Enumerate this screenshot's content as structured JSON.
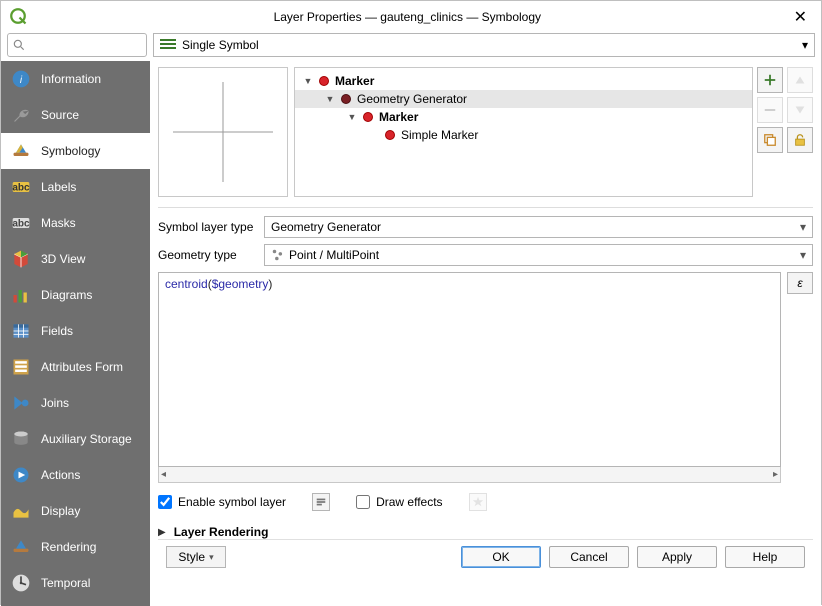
{
  "window": {
    "title": "Layer Properties — gauteng_clinics — Symbology"
  },
  "search": {
    "placeholder": ""
  },
  "renderer_dropdown": {
    "value": "Single Symbol"
  },
  "sidebar": {
    "items": [
      {
        "label": "Information"
      },
      {
        "label": "Source"
      },
      {
        "label": "Symbology"
      },
      {
        "label": "Labels"
      },
      {
        "label": "Masks"
      },
      {
        "label": "3D View"
      },
      {
        "label": "Diagrams"
      },
      {
        "label": "Fields"
      },
      {
        "label": "Attributes Form"
      },
      {
        "label": "Joins"
      },
      {
        "label": "Auxiliary Storage"
      },
      {
        "label": "Actions"
      },
      {
        "label": "Display"
      },
      {
        "label": "Rendering"
      },
      {
        "label": "Temporal"
      }
    ],
    "selected_index": 2
  },
  "symbol_tree": {
    "items": [
      {
        "indent": 0,
        "expand": true,
        "dot": "red",
        "label": "Marker",
        "bold": true,
        "selected": false
      },
      {
        "indent": 1,
        "expand": true,
        "dot": "dark",
        "label": "Geometry Generator",
        "bold": false,
        "selected": true
      },
      {
        "indent": 2,
        "expand": true,
        "dot": "red",
        "label": "Marker",
        "bold": true,
        "selected": false
      },
      {
        "indent": 3,
        "expand": false,
        "dot": "red",
        "label": "Simple Marker",
        "bold": false,
        "selected": false
      }
    ]
  },
  "symbol_layer_type": {
    "label": "Symbol layer type",
    "value": "Geometry Generator"
  },
  "geometry_type": {
    "label": "Geometry type",
    "value": "Point / MultiPoint"
  },
  "expression": {
    "tokens": [
      {
        "t": "centroid",
        "c": "fn"
      },
      {
        "t": "(",
        "c": "pn"
      },
      {
        "t": "$geometry",
        "c": "kw"
      },
      {
        "t": ")",
        "c": "pn"
      }
    ],
    "epsilon": "ε"
  },
  "checks": {
    "enable_symbol_layer": {
      "label": "Enable symbol layer",
      "checked": true
    },
    "draw_effects": {
      "label": "Draw effects",
      "checked": false
    }
  },
  "layer_rendering": {
    "label": "Layer Rendering"
  },
  "buttons": {
    "style": "Style",
    "ok": "OK",
    "cancel": "Cancel",
    "apply": "Apply",
    "help": "Help"
  }
}
